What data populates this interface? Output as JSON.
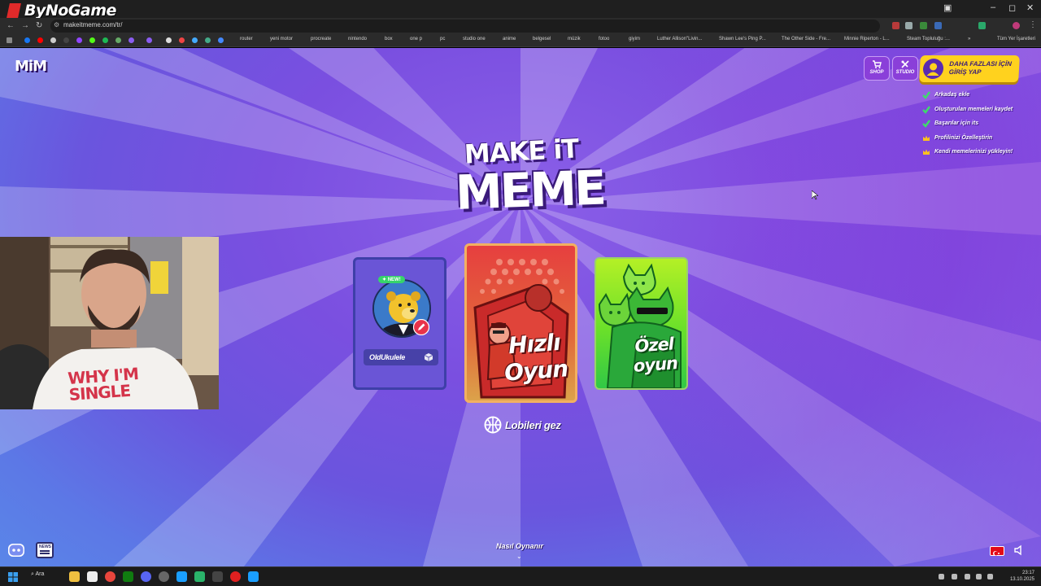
{
  "stream": {
    "watermark": "ByNoGame",
    "webcam_shirt_text": "WHY I'M\nSINGLE"
  },
  "browser": {
    "url": "makeitmeme.com/tr/",
    "bookmarks": [
      "router",
      "yeni motor",
      "procreate",
      "nintendo",
      "box",
      "one p",
      "pc",
      "studio one",
      "anime",
      "belgesel",
      "müzik",
      "fotoo",
      "giyim",
      "Luther Allison\"Livin...",
      "Shawn Lee's Ping P...",
      "The Other Side - Fre...",
      "Minnie Riperton - L...",
      "Steam Topluluğu :...",
      "Tüm Yer İşaretleri"
    ]
  },
  "game": {
    "logo": "MiM",
    "title_top": "MAKE iT",
    "title_main": "MEME",
    "shop_label": "SHOP",
    "studio_label": "STUDIO",
    "login_label": "DAHA FAZLASI İÇİN GİRİŞ YAP",
    "benefits": [
      {
        "text": "Arkadaş ekle",
        "icon": "check-icon"
      },
      {
        "text": "Oluşturulan memeleri kaydet",
        "icon": "check-icon"
      },
      {
        "text": "Başarılar için its",
        "icon": "check-icon"
      },
      {
        "text": "Profilinizi Özelleştirin",
        "icon": "crown-icon"
      },
      {
        "text": "Kendi memelerinizi yükleyin!",
        "icon": "crown-icon"
      }
    ],
    "new_badge": "✦ NEW!",
    "rooms_card_label": "OldUkulele",
    "quick_play": "Hızlı\nOyun",
    "custom_game": "Özel\noyun",
    "browse_lobbies": "Lobileri gez",
    "how_to_play": "Nasıl Oynanır",
    "news_label": "NEWS",
    "colors": {
      "accent_yellow": "#ffd21e",
      "quick_red": "#e63f3f",
      "custom_green": "#6ae02a"
    }
  },
  "taskbar": {
    "search": "Ara",
    "time": "23:17",
    "date": "13.10.2025"
  }
}
